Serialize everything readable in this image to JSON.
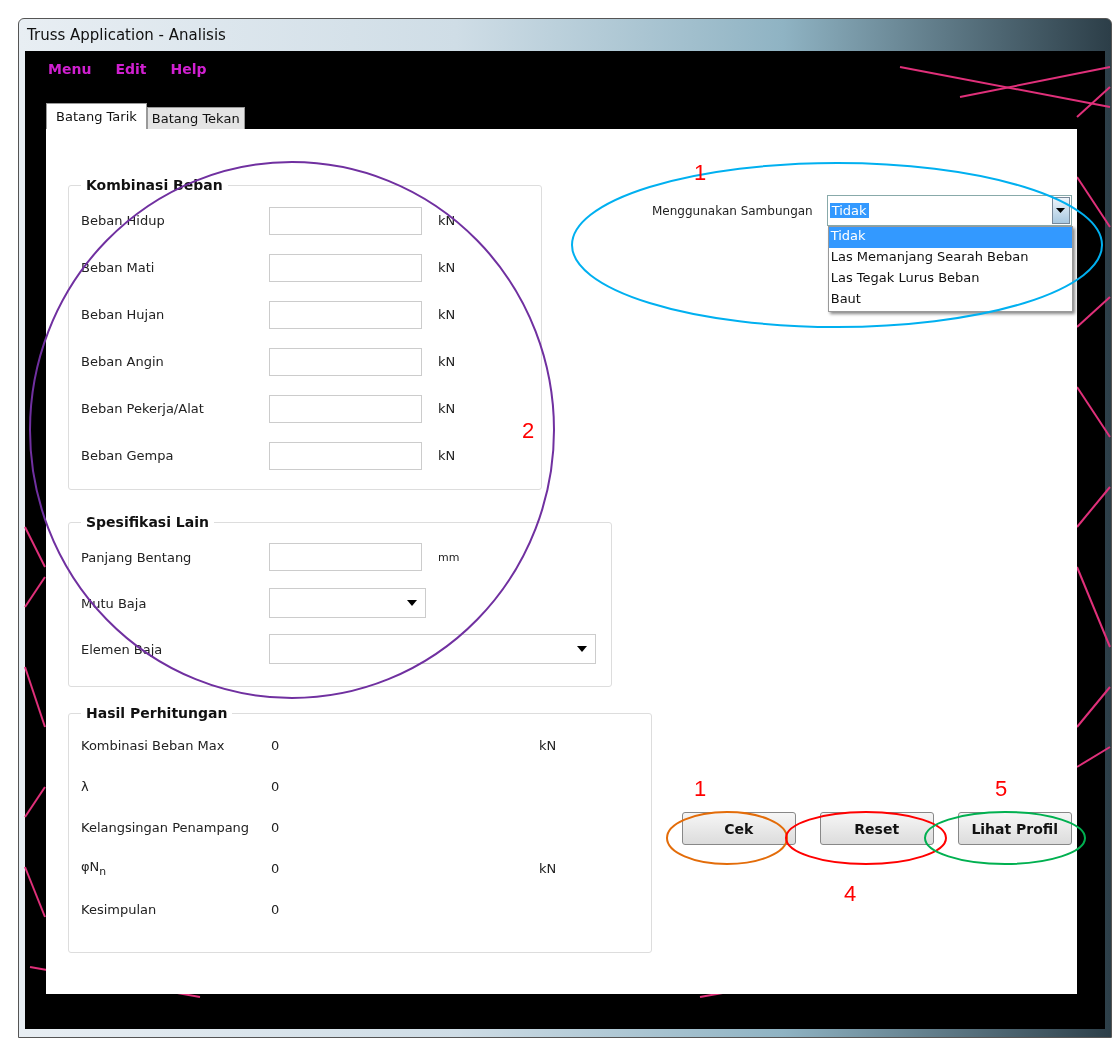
{
  "window": {
    "title": "Truss Application - Analisis"
  },
  "menu": [
    "Menu",
    "Edit",
    "Help"
  ],
  "tabs": [
    {
      "label": "Batang Tarik",
      "selected": true
    },
    {
      "label": "Batang Tekan",
      "selected": false
    }
  ],
  "kombinasi_beban": {
    "title": "Kombinasi Beban",
    "fields": [
      {
        "label": "Beban Hidup",
        "unit": "kN"
      },
      {
        "label": "Beban Mati",
        "unit": "kN"
      },
      {
        "label": "Beban Hujan",
        "unit": "kN"
      },
      {
        "label": "Beban Angin",
        "unit": "kN"
      },
      {
        "label": "Beban Pekerja/Alat",
        "unit": "kN"
      },
      {
        "label": "Beban Gempa",
        "unit": "kN"
      }
    ]
  },
  "spesifikasi_lain": {
    "title": "Spesifikasi Lain",
    "fields": [
      {
        "kind": "input",
        "label": "Panjang Bentang",
        "unit": "mm"
      },
      {
        "kind": "select",
        "label": "Mutu Baja"
      },
      {
        "kind": "select",
        "label": "Elemen Baja"
      }
    ]
  },
  "hasil_perhitungan": {
    "title": "Hasil Perhitungan",
    "rows": [
      {
        "label": "Kombinasi Beban Max",
        "value": "0",
        "unit": "kN"
      },
      {
        "label": "λ",
        "value": "0"
      },
      {
        "label": "Kelangsingan Penampang",
        "value": "0"
      },
      {
        "label": "φN$_{n}$",
        "value": "0",
        "unit": "kN"
      },
      {
        "label": "Kesimpulan",
        "value": "0"
      }
    ]
  },
  "sambungan": {
    "label": "Menggunakan Sambungan",
    "value": "Tidak",
    "options": [
      {
        "label": "Tidak",
        "selected": true
      },
      {
        "label": "Las Memanjang Searah Beban",
        "selected": false
      },
      {
        "label": "Las Tegak Lurus Beban",
        "selected": false
      },
      {
        "label": "Baut",
        "selected": false
      }
    ]
  },
  "buttons": [
    "Cek",
    "Reset",
    "Lihat Profil"
  ],
  "annotations": [
    {
      "label": "1",
      "color": "#00b0f0"
    },
    {
      "label": "2",
      "color": "#7030a0"
    },
    {
      "label": "1",
      "color": "#e36c09"
    },
    {
      "label": "4",
      "color": "#ff0000"
    },
    {
      "label": "5",
      "color": "#00b050"
    }
  ]
}
